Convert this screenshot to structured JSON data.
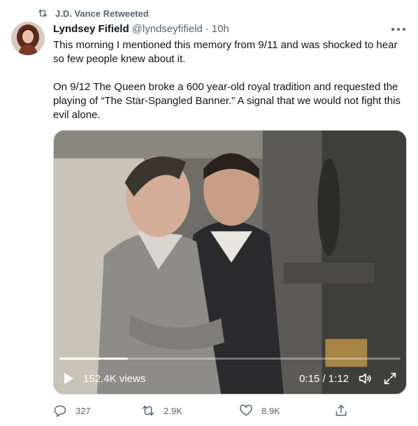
{
  "retweet_notice": {
    "text": "J.D. Vance Retweeted",
    "icon": "retweet-icon"
  },
  "author": {
    "name": "Lyndsey Fifield",
    "handle": "@lyndseyfifield",
    "separator": "·",
    "time": "10h"
  },
  "tweet": {
    "paragraph_1": "This morning I mentioned this memory from 9/11 and was shocked to hear so few people knew about it.",
    "paragraph_2": "On 9/12 The Queen broke a 600 year-old royal tradition and requested the playing of “The Star-Spangled Banner.” A signal that we would not fight this evil alone."
  },
  "video": {
    "views": "152.4K views",
    "timecode": "0:15 / 1:12",
    "progress_fraction": 0.2
  },
  "actions": {
    "replies": "327",
    "retweets": "2.9K",
    "likes": "8.9K"
  },
  "colors": {
    "text_primary": "#0f1419",
    "text_secondary": "#536471",
    "border": "#cfd9de"
  }
}
